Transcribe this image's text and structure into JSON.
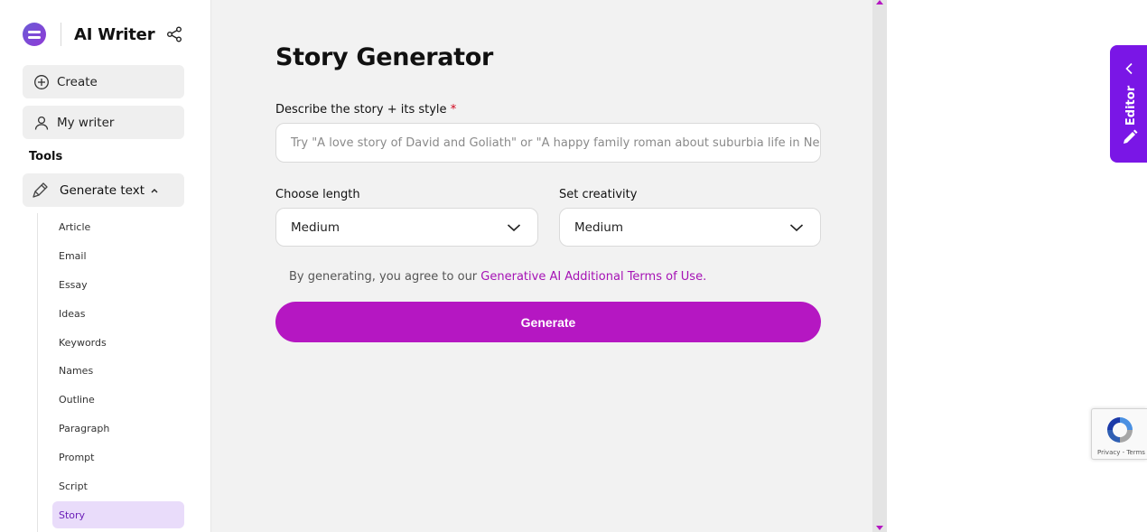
{
  "brand": {
    "title": "AI Writer"
  },
  "sidebar": {
    "create_label": "Create",
    "my_writer_label": "My writer",
    "tools_heading": "Tools",
    "generate_text_label": "Generate text",
    "items": [
      {
        "label": "Article"
      },
      {
        "label": "Email"
      },
      {
        "label": "Essay"
      },
      {
        "label": "Ideas"
      },
      {
        "label": "Keywords"
      },
      {
        "label": "Names"
      },
      {
        "label": "Outline"
      },
      {
        "label": "Paragraph"
      },
      {
        "label": "Prompt"
      },
      {
        "label": "Script"
      },
      {
        "label": "Story",
        "active": true
      }
    ]
  },
  "main": {
    "title": "Story Generator",
    "describe_label": "Describe the story + its style",
    "required_mark": "*",
    "describe_placeholder": "Try \"A love story of David and Goliath\" or \"A happy family roman about suburbia life in New York",
    "length_label": "Choose length",
    "length_value": "Medium",
    "creativity_label": "Set creativity",
    "creativity_value": "Medium",
    "terms_prefix": "By generating, you agree to our ",
    "terms_link": "Generative AI Additional Terms of Use.",
    "generate_button": "Generate"
  },
  "editor_tab": {
    "label": "Editor"
  },
  "recaptcha": {
    "text": "Privacy - Terms"
  },
  "colors": {
    "accent": "#b517c2",
    "editor": "#7a16e6",
    "active_bg": "#e9dcfa"
  }
}
